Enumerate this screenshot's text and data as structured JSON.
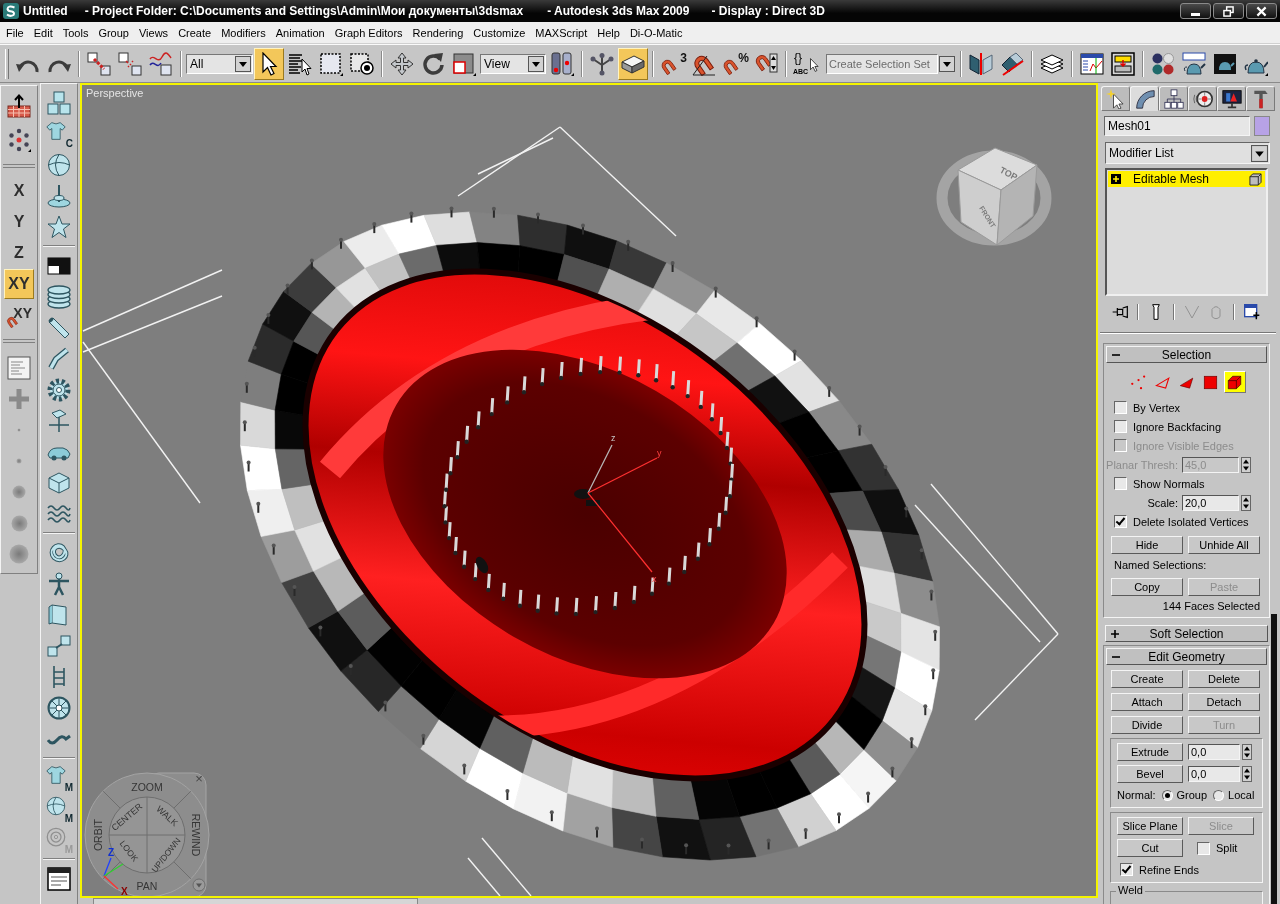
{
  "window": {
    "title": "Untitled",
    "project_folder": "- Project Folder: C:\\Documents and Settings\\Admin\\Мои документы\\3dsmax",
    "application": "- Autodesk 3ds Max 2009",
    "display": "- Display : Direct 3D"
  },
  "menu_bar": [
    "File",
    "Edit",
    "Tools",
    "Group",
    "Views",
    "Create",
    "Modifiers",
    "Animation",
    "Graph Editors",
    "Rendering",
    "Customize",
    "MAXScript",
    "Help",
    "Di-O-Matic"
  ],
  "main_toolbar": {
    "selection_filter": "All",
    "select_object": {
      "selected": true
    },
    "reference_coordinate_system": "View",
    "keyboard_shortcut_override": {
      "selected": true
    },
    "snap_toggle_label": "3",
    "percent_snap_label": "%",
    "named_selection_labels": [
      "{}",
      "ABC"
    ],
    "named_selection_set": {
      "placeholder": "Create Selection Set"
    }
  },
  "axis_toolbar": [
    {
      "kind": "axis",
      "label": "X",
      "selected": false
    },
    {
      "kind": "axis",
      "label": "Y",
      "selected": false
    },
    {
      "kind": "axis",
      "label": "Z",
      "selected": false
    },
    {
      "kind": "axis",
      "label": "XY",
      "selected": true
    },
    {
      "kind": "snap",
      "label": "XY",
      "selected": false
    }
  ],
  "object_toolbar": {
    "letter_buttons": [
      {
        "letter": "C",
        "disabled": false
      },
      {
        "letter": "M",
        "disabled": false
      },
      {
        "letter": "M",
        "disabled": false
      },
      {
        "letter": "M",
        "disabled": true
      }
    ]
  },
  "viewport": {
    "label": "Perspective",
    "gizmo_axes": [
      "z",
      "y",
      "x"
    ],
    "viewcube_faces": [
      "TOP",
      "FRONT"
    ],
    "steering_wheel": {
      "labels": [
        "ZOOM",
        "ORBIT",
        "CENTER",
        "WALK",
        "REWIND",
        "LOOK",
        "UP/DOWN",
        "PAN"
      ],
      "close": "×",
      "tripod_axes": [
        "Z",
        "X"
      ]
    }
  },
  "command_panel": {
    "tabs": [
      {
        "selected": false
      },
      {
        "selected": true
      },
      {
        "selected": false
      },
      {
        "selected": false
      },
      {
        "selected": false
      },
      {
        "selected": false
      }
    ],
    "object": {
      "name": "Mesh01",
      "color": "#b7a2e6"
    },
    "modifier_list": "Modifier List",
    "modifier_stack": [
      {
        "label": "Editable Mesh",
        "selected": true,
        "expanded": false
      }
    ],
    "stack_buttons": [
      {
        "disabled": false
      },
      {
        "disabled": false
      },
      {
        "disabled": true
      },
      {
        "disabled": true
      },
      {
        "disabled": false
      }
    ],
    "rollouts": [
      {
        "title": "Selection",
        "expanded": true,
        "rows": [
          {
            "kind": "subobjects",
            "items": [
              {
                "selected": false
              },
              {
                "selected": false
              },
              {
                "selected": false
              },
              {
                "selected": false
              },
              {
                "selected": true
              }
            ]
          },
          {
            "kind": "checkbox",
            "label": "By Vertex",
            "checked": false,
            "disabled": false
          },
          {
            "kind": "checkbox",
            "label": "Ignore Backfacing",
            "checked": false,
            "disabled": false
          },
          {
            "kind": "checkbox",
            "label": "Ignore Visible Edges",
            "checked": false,
            "disabled": true
          },
          {
            "kind": "spinner",
            "label": "Planar Thresh:",
            "value": "45,0",
            "disabled": true
          },
          {
            "kind": "checkbox",
            "label": "Show Normals",
            "checked": false,
            "disabled": false
          },
          {
            "kind": "spinner",
            "label": "Scale:",
            "value": "20,0",
            "disabled": false
          },
          {
            "kind": "checkbox",
            "label": "Delete Isolated Vertices",
            "checked": true,
            "disabled": false
          },
          {
            "kind": "buttons",
            "items": [
              {
                "label": "Hide",
                "disabled": false
              },
              {
                "label": "Unhide All",
                "disabled": false
              }
            ]
          },
          {
            "kind": "text",
            "text": "Named Selections:"
          },
          {
            "kind": "buttons",
            "items": [
              {
                "label": "Copy",
                "disabled": false
              },
              {
                "label": "Paste",
                "disabled": true
              }
            ]
          },
          {
            "kind": "status",
            "text": "144 Faces Selected"
          }
        ]
      },
      {
        "title": "Soft Selection",
        "expanded": false
      },
      {
        "title": "Edit Geometry",
        "expanded": true,
        "rows": [
          {
            "kind": "buttons",
            "items": [
              {
                "label": "Create",
                "disabled": false
              },
              {
                "label": "Delete",
                "disabled": false
              }
            ]
          },
          {
            "kind": "buttons",
            "items": [
              {
                "label": "Attach",
                "disabled": false
              },
              {
                "label": "Detach",
                "disabled": false
              }
            ]
          },
          {
            "kind": "buttons",
            "items": [
              {
                "label": "Divide",
                "disabled": false
              },
              {
                "label": "Turn",
                "disabled": true
              }
            ]
          },
          {
            "kind": "group",
            "rows": [
              {
                "kind": "button_spinner",
                "label": "Extrude",
                "value": "0,0"
              },
              {
                "kind": "button_spinner",
                "label": "Bevel",
                "value": "0,0"
              },
              {
                "kind": "radios",
                "label": "Normal:",
                "items": [
                  {
                    "label": "Group",
                    "selected": true
                  },
                  {
                    "label": "Local",
                    "selected": false
                  }
                ]
              }
            ]
          },
          {
            "kind": "group",
            "rows": [
              {
                "kind": "buttons",
                "items": [
                  {
                    "label": "Slice Plane",
                    "disabled": false
                  },
                  {
                    "label": "Slice",
                    "disabled": true
                  }
                ]
              },
              {
                "kind": "button_checkbox",
                "label": "Cut",
                "checkbox": {
                  "label": "Split",
                  "checked": false
                }
              },
              {
                "kind": "checkbox",
                "label": "Refine Ends",
                "checked": true,
                "disabled": false
              }
            ]
          },
          {
            "kind": "group",
            "title": "Weld"
          }
        ]
      }
    ]
  }
}
